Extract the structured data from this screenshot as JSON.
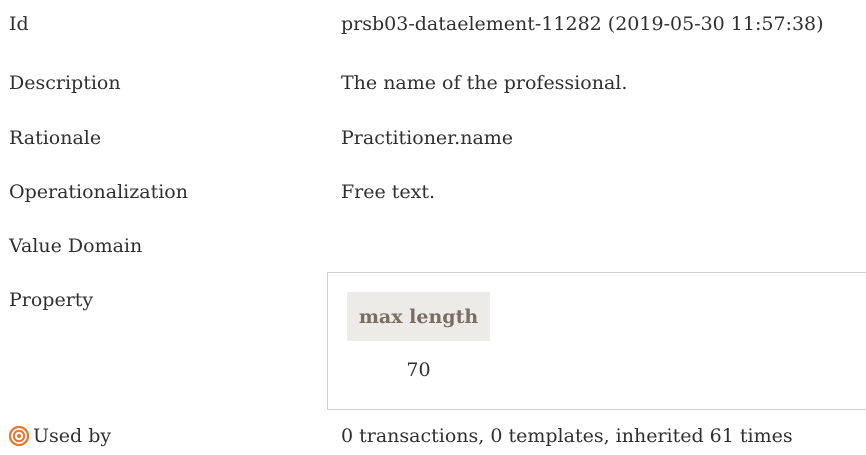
{
  "rows": {
    "id": {
      "label": "Id",
      "value": "prsb03-dataelement-11282 (2019-05-30 11:57:38)"
    },
    "description": {
      "label": "Description",
      "value": "The name of the professional."
    },
    "rationale": {
      "label": "Rationale",
      "value": "Practitioner.name"
    },
    "operationalization": {
      "label": "Operationalization",
      "value": "Free text."
    },
    "value_domain": {
      "label": "Value Domain"
    },
    "property": {
      "label": "Property",
      "header": "max length",
      "value": "70"
    },
    "used_by": {
      "label": "Used by",
      "value": "0 transactions, 0 templates, inherited 61 times",
      "icon": "target-icon",
      "icon_color": "#e8732a"
    }
  }
}
